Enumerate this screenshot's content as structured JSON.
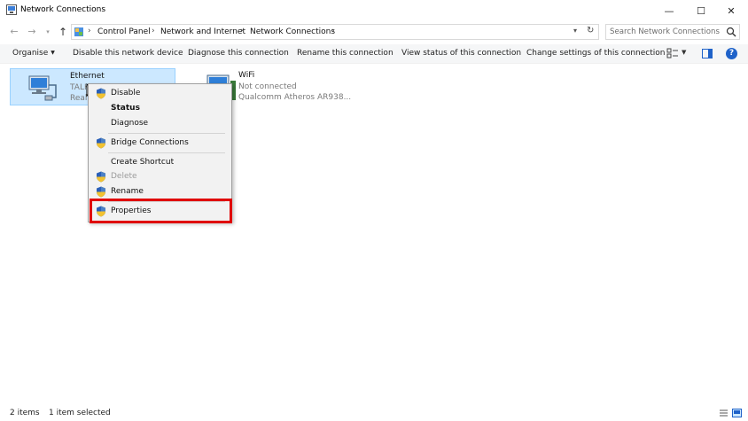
{
  "window": {
    "title": "Network Connections",
    "controls": {
      "minimize": "—",
      "maximize": "☐",
      "close": "✕"
    }
  },
  "address": {
    "crumbs": [
      "Control Panel",
      "Network and Internet",
      "Network Connections"
    ],
    "separator": "›",
    "search_placeholder": "Search Network Connections"
  },
  "commandbar": {
    "organise": "Organise",
    "disable_device": "Disable this network device",
    "diagnose": "Diagnose this connection",
    "rename": "Rename this connection",
    "view_status": "View status of this connection",
    "change_settings": "Change settings of this connection",
    "help": "?"
  },
  "items": [
    {
      "name": "Ethernet",
      "line1": "TALK",
      "line2": "Realt",
      "selected": true
    },
    {
      "name": "WiFi",
      "line1": "Not connected",
      "line2": "Qualcomm Atheros AR938...",
      "selected": false
    }
  ],
  "context_menu": {
    "items": [
      {
        "label": "Disable",
        "shield": true,
        "bold": false,
        "disabled": false
      },
      {
        "label": "Status",
        "shield": false,
        "bold": true,
        "disabled": false
      },
      {
        "label": "Diagnose",
        "shield": false,
        "bold": false,
        "disabled": false
      },
      {
        "label": "Bridge Connections",
        "shield": true,
        "bold": false,
        "disabled": false
      },
      {
        "label": "Create Shortcut",
        "shield": false,
        "bold": false,
        "disabled": false
      },
      {
        "label": "Delete",
        "shield": true,
        "bold": false,
        "disabled": true
      },
      {
        "label": "Rename",
        "shield": true,
        "bold": false,
        "disabled": false
      },
      {
        "label": "Properties",
        "shield": true,
        "bold": false,
        "disabled": false
      }
    ],
    "highlighted": "Properties",
    "highlight_color": "#e00000"
  },
  "statusbar": {
    "count": "2 items",
    "selected": "1 item selected"
  },
  "colors": {
    "selection_fill": "#cce8ff",
    "selection_border": "#99d1ff",
    "help_blue": "#1f62c9"
  }
}
